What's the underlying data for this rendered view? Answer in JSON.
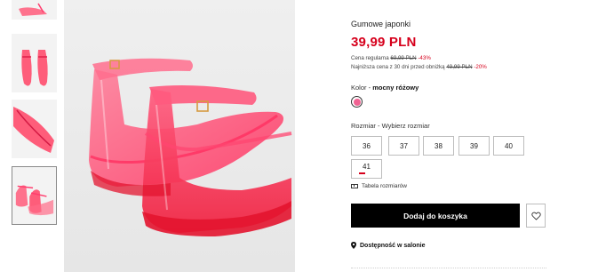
{
  "product": {
    "title": "Gumowe japonki",
    "price": "39,99 PLN",
    "regular_label": "Cena regularna",
    "regular_price": "69,99 PLN",
    "regular_discount": "-43%",
    "lowest_label": "Najniższa cena z 30 dni przed obniżką",
    "lowest_price": "49,99 PLN",
    "lowest_discount": "-20%"
  },
  "color": {
    "label": "Kolor - ",
    "value": "mocny różowy",
    "swatch_hex": "#f06292"
  },
  "sizes": {
    "label": "Rozmiar  - Wybierz rozmiar",
    "options": [
      "36",
      "37",
      "38",
      "39",
      "40",
      "41"
    ]
  },
  "size_guide": "Tabela rozmiarów",
  "actions": {
    "add_to_cart": "Dodaj do koszyka"
  },
  "availability": "Dostępność w salonie",
  "colors": {
    "accent_red": "#d6001c",
    "product_pink": "#ff3d6e",
    "button_black": "#000000"
  }
}
